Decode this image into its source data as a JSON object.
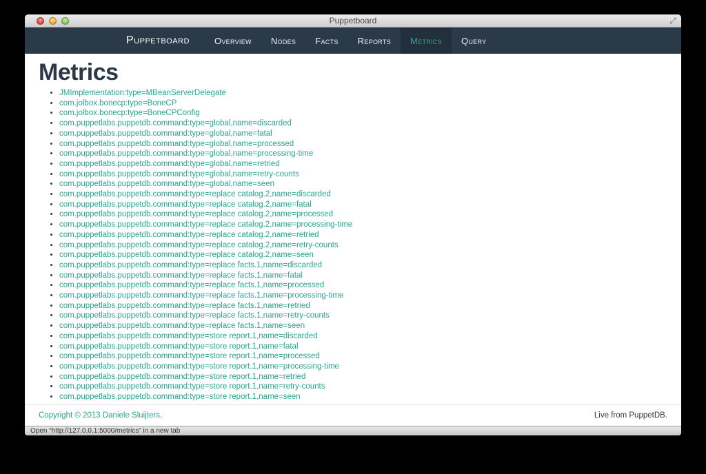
{
  "window": {
    "title": "Puppetboard",
    "statusbar_text": "Open “http://127.0.0.1:5000/metrics” in a new tab"
  },
  "icons": {
    "fullscreen": "⤢"
  },
  "navbar": {
    "brand": "Puppetboard",
    "items": [
      {
        "label": "Overview",
        "active": false
      },
      {
        "label": "Nodes",
        "active": false
      },
      {
        "label": "Facts",
        "active": false
      },
      {
        "label": "Reports",
        "active": false
      },
      {
        "label": "Metrics",
        "active": true
      },
      {
        "label": "Query",
        "active": false
      }
    ]
  },
  "page": {
    "title": "Metrics",
    "metrics": [
      "JMImplementation:type=MBeanServerDelegate",
      "com.jolbox.bonecp:type=BoneCP",
      "com.jolbox.bonecp:type=BoneCPConfig",
      "com.puppetlabs.puppetdb.command:type=global,name=discarded",
      "com.puppetlabs.puppetdb.command:type=global,name=fatal",
      "com.puppetlabs.puppetdb.command:type=global,name=processed",
      "com.puppetlabs.puppetdb.command:type=global,name=processing-time",
      "com.puppetlabs.puppetdb.command:type=global,name=retried",
      "com.puppetlabs.puppetdb.command:type=global,name=retry-counts",
      "com.puppetlabs.puppetdb.command:type=global,name=seen",
      "com.puppetlabs.puppetdb.command:type=replace catalog.2,name=discarded",
      "com.puppetlabs.puppetdb.command:type=replace catalog.2,name=fatal",
      "com.puppetlabs.puppetdb.command:type=replace catalog.2,name=processed",
      "com.puppetlabs.puppetdb.command:type=replace catalog.2,name=processing-time",
      "com.puppetlabs.puppetdb.command:type=replace catalog.2,name=retried",
      "com.puppetlabs.puppetdb.command:type=replace catalog.2,name=retry-counts",
      "com.puppetlabs.puppetdb.command:type=replace catalog.2,name=seen",
      "com.puppetlabs.puppetdb.command:type=replace facts.1,name=discarded",
      "com.puppetlabs.puppetdb.command:type=replace facts.1,name=fatal",
      "com.puppetlabs.puppetdb.command:type=replace facts.1,name=processed",
      "com.puppetlabs.puppetdb.command:type=replace facts.1,name=processing-time",
      "com.puppetlabs.puppetdb.command:type=replace facts.1,name=retried",
      "com.puppetlabs.puppetdb.command:type=replace facts.1,name=retry-counts",
      "com.puppetlabs.puppetdb.command:type=replace facts.1,name=seen",
      "com.puppetlabs.puppetdb.command:type=store report.1,name=discarded",
      "com.puppetlabs.puppetdb.command:type=store report.1,name=fatal",
      "com.puppetlabs.puppetdb.command:type=store report.1,name=processed",
      "com.puppetlabs.puppetdb.command:type=store report.1,name=processing-time",
      "com.puppetlabs.puppetdb.command:type=store report.1,name=retried",
      "com.puppetlabs.puppetdb.command:type=store report.1,name=retry-counts",
      "com.puppetlabs.puppetdb.command:type=store report.1,name=seen"
    ]
  },
  "footer": {
    "copyright": "Copyright © 2013 Daniele Sluijters",
    "copyright_suffix": ".",
    "right_text": "Live from PuppetDB."
  },
  "colors": {
    "link": "#26a690",
    "navbar_bg": "#2b3a49",
    "navbar_active_bg": "#222f3c",
    "navbar_active_text": "#3aa189",
    "heading": "#2b3947"
  }
}
